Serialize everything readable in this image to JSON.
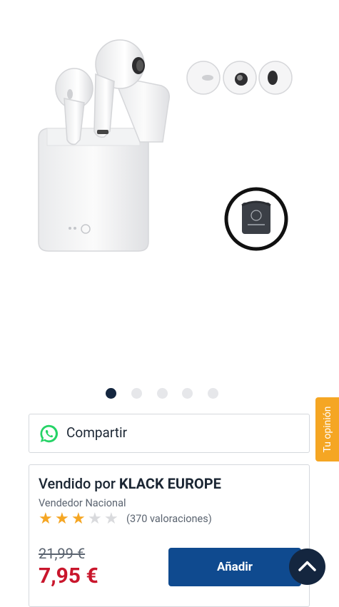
{
  "gallery": {
    "images": [
      {
        "name": "product-photo-1",
        "selected": true
      },
      {
        "name": "product-photo-2",
        "selected": false
      },
      {
        "name": "product-photo-3",
        "selected": false
      },
      {
        "name": "product-photo-4",
        "selected": false
      },
      {
        "name": "product-photo-5",
        "selected": false
      }
    ]
  },
  "share": {
    "label": "Compartir",
    "icon": "whatsapp-icon",
    "icon_color": "#25d366"
  },
  "opinion_tab": {
    "label": "Tu opinión",
    "color": "#f5a623"
  },
  "seller": {
    "prefix": "Vendido por",
    "name": "KLACK EUROPE",
    "type": "Vendedor Nacional",
    "rating": 3,
    "rating_max": 5,
    "rating_count": "(370 valoraciones)",
    "star_color": "#f5a623"
  },
  "pricing": {
    "old_price": "21,99 €",
    "price": "7,95 €",
    "price_color": "#c9162c"
  },
  "actions": {
    "add_label": "Añadir",
    "add_color": "#0f4a8f",
    "scroll_top_icon": "chevron-up-icon"
  }
}
